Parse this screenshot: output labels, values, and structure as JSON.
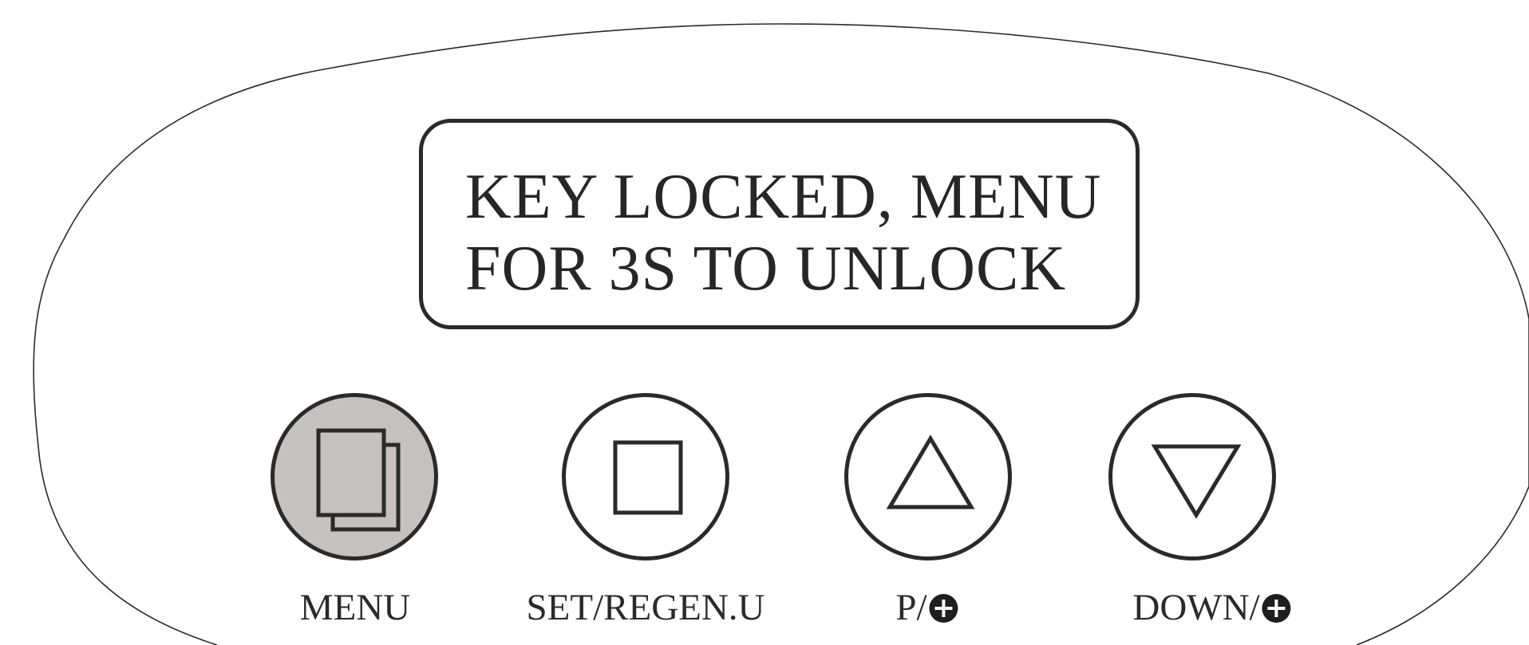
{
  "display": {
    "line1": "KEY LOCKED, MENU",
    "line2": "FOR 3S TO UNLOCK"
  },
  "buttons": [
    {
      "label": "MENU",
      "icon": "menu-pages-icon",
      "active": true
    },
    {
      "label": "SET/REGEN.U",
      "icon": "square-icon",
      "active": false
    },
    {
      "label": "P/",
      "icon": "up-triangle-icon",
      "badge": "plus-circle-icon",
      "active": false
    },
    {
      "label": "DOWN/",
      "icon": "down-triangle-icon",
      "badge": "plus-circle-icon",
      "active": false
    }
  ],
  "colors": {
    "outline": "#2b2a2a",
    "active_key_fill": "#c5c1c1",
    "background": "#ffffff"
  }
}
